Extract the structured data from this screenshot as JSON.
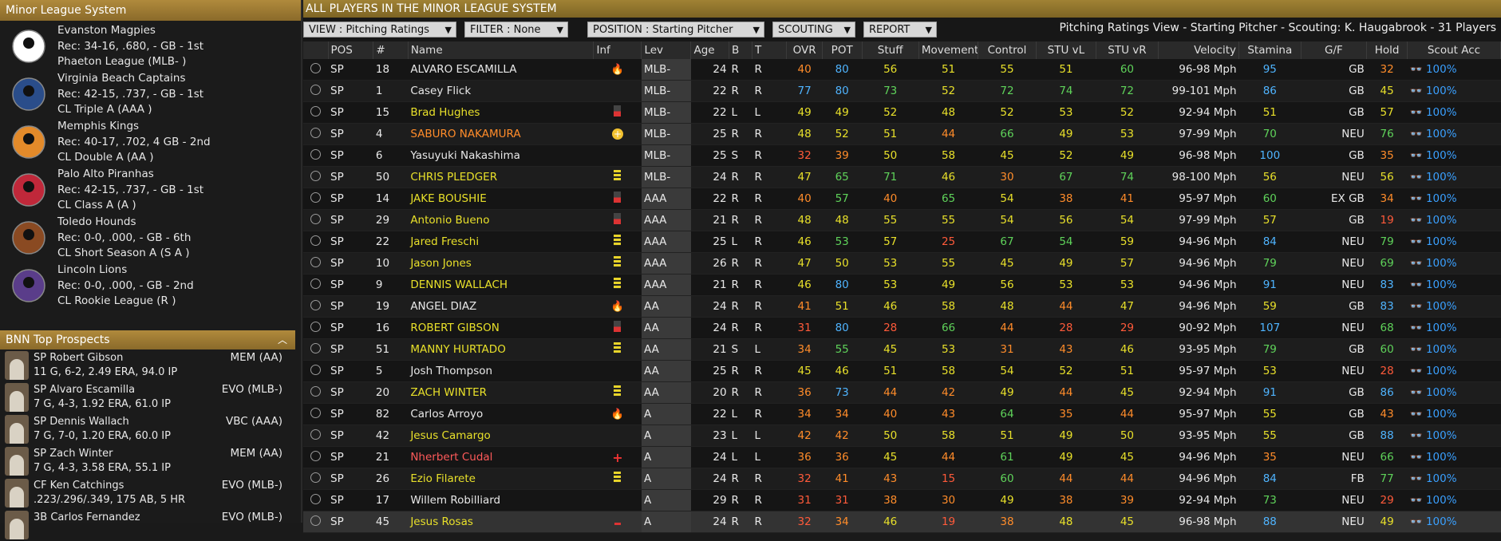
{
  "left_header": "Minor League System",
  "teams": [
    {
      "name": "Evanston Magpies",
      "rec": "Rec: 34-16, .680, - GB - 1st",
      "league": "Phaeton League (MLB- )",
      "color": "#ffffff",
      "icon": "magpie-logo-icon"
    },
    {
      "name": "Virginia Beach Captains",
      "rec": "Rec: 42-15, .737, - GB - 1st",
      "league": "CL Triple A (AAA )",
      "color": "#2a4d8a",
      "icon": "captain-logo-icon"
    },
    {
      "name": "Memphis Kings",
      "rec": "Rec: 40-17, .702, 4 GB - 2nd",
      "league": "CL Double A (AA )",
      "color": "#e38a2a",
      "icon": "crown-logo-icon"
    },
    {
      "name": "Palo Alto Piranhas",
      "rec": "Rec: 42-15, .737, - GB - 1st",
      "league": "CL Class A (A )",
      "color": "#c0283a",
      "icon": "piranha-logo-icon"
    },
    {
      "name": "Toledo Hounds",
      "rec": "Rec: 0-0, .000, - GB - 6th",
      "league": "CL Short Season A (S A )",
      "color": "#8a4a22",
      "icon": "hound-logo-icon"
    },
    {
      "name": "Lincoln Lions",
      "rec": "Rec: 0-0, .000, - GB - 2nd",
      "league": "CL Rookie League (R )",
      "color": "#5a3d8a",
      "icon": "lion-logo-icon"
    }
  ],
  "prospects_header": "BNN Top Prospects",
  "prospects": [
    {
      "name": "SP Robert Gibson",
      "stats": "11 G, 6-2, 2.49 ERA, 94.0 IP",
      "team": "MEM (AA)"
    },
    {
      "name": "SP Alvaro Escamilla",
      "stats": "7 G, 4-3, 1.92 ERA, 61.0 IP",
      "team": "EVO (MLB-)"
    },
    {
      "name": "SP Dennis Wallach",
      "stats": "7 G, 7-0, 1.20 ERA, 60.0 IP",
      "team": "VBC (AAA)"
    },
    {
      "name": "SP Zach Winter",
      "stats": "7 G, 4-3, 3.58 ERA, 55.1 IP",
      "team": "MEM (AA)"
    },
    {
      "name": "CF Ken Catchings",
      "stats": ".223/.296/.349, 175 AB, 5 HR",
      "team": "EVO (MLB-)"
    },
    {
      "name": "3B Carlos Fernandez",
      "stats": "",
      "team": "EVO (MLB-)"
    }
  ],
  "main_header": "ALL PLAYERS IN THE MINOR LEAGUE SYSTEM",
  "toolbar": {
    "view": "VIEW : Pitching Ratings",
    "filter": "FILTER : None",
    "position": "POSITION : Starting Pitcher",
    "scouting": "SCOUTING",
    "report": "REPORT",
    "info": "Pitching Ratings View - Starting Pitcher - Scouting: K. Haugabrook - 31 Players"
  },
  "columns": [
    "",
    "POS",
    "#",
    "Name",
    "Inf",
    "Lev",
    "Age",
    "B",
    "T",
    "OVR",
    "POT",
    "Stuff",
    "Movement",
    "Control",
    "STU vL",
    "STU vR",
    "Velocity",
    "Stamina",
    "G/F",
    "Hold",
    "Scout Acc"
  ],
  "colors": {
    "red": "#ff5a3a",
    "orange": "#ff8c2a",
    "yellow": "#e8e02a",
    "green": "#5fd35a",
    "blue": "#4fb4ff",
    "white": "#e8e8e8",
    "red_name": "#ff5a5a"
  },
  "rows": [
    {
      "pos": "SP",
      "num": "18",
      "name": "ALVARO ESCAMILLA",
      "nc": "white",
      "inf": "fire",
      "lev": "MLB-",
      "age": "24",
      "b": "R",
      "t": "R",
      "ovr": "40",
      "ovrc": "orange",
      "pot": "80",
      "potc": "blue",
      "stuff": "56",
      "stc": "yellow",
      "mov": "51",
      "mvc": "yellow",
      "con": "55",
      "coc": "yellow",
      "vl": "51",
      "vlc": "yellow",
      "vr": "60",
      "vrc": "green",
      "velo": "96-98 Mph",
      "sta": "95",
      "sac": "blue",
      "gf": "GB",
      "hold": "32",
      "hoc": "orange",
      "acc": "100%"
    },
    {
      "pos": "SP",
      "num": "1",
      "name": "Casey Flick",
      "nc": "white",
      "inf": "",
      "lev": "MLB-",
      "age": "22",
      "b": "R",
      "t": "R",
      "ovr": "77",
      "ovrc": "blue",
      "pot": "80",
      "potc": "blue",
      "stuff": "73",
      "stc": "green",
      "mov": "52",
      "mvc": "yellow",
      "con": "72",
      "coc": "green",
      "vl": "74",
      "vlc": "green",
      "vr": "72",
      "vrc": "green",
      "velo": "99-101 Mph",
      "sta": "86",
      "sac": "blue",
      "gf": "GB",
      "hold": "45",
      "hoc": "yellow",
      "acc": "100%"
    },
    {
      "pos": "SP",
      "num": "15",
      "name": "Brad Hughes",
      "nc": "yellow",
      "inf": "bar-red",
      "lev": "MLB-",
      "age": "22",
      "b": "L",
      "t": "L",
      "ovr": "49",
      "ovrc": "yellow",
      "pot": "49",
      "potc": "yellow",
      "stuff": "52",
      "stc": "yellow",
      "mov": "48",
      "mvc": "yellow",
      "con": "52",
      "coc": "yellow",
      "vl": "53",
      "vlc": "yellow",
      "vr": "52",
      "vrc": "yellow",
      "velo": "92-94 Mph",
      "sta": "51",
      "sac": "yellow",
      "gf": "GB",
      "hold": "57",
      "hoc": "yellow",
      "acc": "100%"
    },
    {
      "pos": "SP",
      "num": "4",
      "name": "SABURO NAKAMURA",
      "nc": "orange",
      "inf": "plus-yellow",
      "lev": "MLB-",
      "age": "25",
      "b": "R",
      "t": "R",
      "ovr": "48",
      "ovrc": "yellow",
      "pot": "52",
      "potc": "yellow",
      "stuff": "51",
      "stc": "yellow",
      "mov": "44",
      "mvc": "orange",
      "con": "66",
      "coc": "green",
      "vl": "49",
      "vlc": "yellow",
      "vr": "53",
      "vrc": "yellow",
      "velo": "97-99 Mph",
      "sta": "70",
      "sac": "green",
      "gf": "NEU",
      "hold": "76",
      "hoc": "green",
      "acc": "100%"
    },
    {
      "pos": "SP",
      "num": "6",
      "name": "Yasuyuki Nakashima",
      "nc": "white",
      "inf": "",
      "lev": "MLB-",
      "age": "25",
      "b": "S",
      "t": "R",
      "ovr": "32",
      "ovrc": "red",
      "pot": "39",
      "potc": "orange",
      "stuff": "50",
      "stc": "yellow",
      "mov": "58",
      "mvc": "yellow",
      "con": "45",
      "coc": "yellow",
      "vl": "52",
      "vlc": "yellow",
      "vr": "49",
      "vrc": "yellow",
      "velo": "96-98 Mph",
      "sta": "100",
      "sac": "blue",
      "gf": "GB",
      "hold": "35",
      "hoc": "orange",
      "acc": "100%"
    },
    {
      "pos": "SP",
      "num": "50",
      "name": "CHRIS PLEDGER",
      "nc": "yellow",
      "inf": "bar-yellow",
      "lev": "MLB-",
      "age": "24",
      "b": "R",
      "t": "R",
      "ovr": "47",
      "ovrc": "yellow",
      "pot": "65",
      "potc": "green",
      "stuff": "71",
      "stc": "green",
      "mov": "46",
      "mvc": "yellow",
      "con": "30",
      "coc": "orange",
      "vl": "67",
      "vlc": "green",
      "vr": "74",
      "vrc": "green",
      "velo": "98-100 Mph",
      "sta": "56",
      "sac": "yellow",
      "gf": "NEU",
      "hold": "56",
      "hoc": "yellow",
      "acc": "100%"
    },
    {
      "pos": "SP",
      "num": "14",
      "name": "JAKE BOUSHIE",
      "nc": "yellow",
      "inf": "bar-red",
      "lev": "AAA",
      "age": "22",
      "b": "R",
      "t": "R",
      "ovr": "40",
      "ovrc": "orange",
      "pot": "57",
      "potc": "green",
      "stuff": "40",
      "stc": "orange",
      "mov": "65",
      "mvc": "green",
      "con": "54",
      "coc": "yellow",
      "vl": "38",
      "vlc": "orange",
      "vr": "41",
      "vrc": "orange",
      "velo": "95-97 Mph",
      "sta": "60",
      "sac": "green",
      "gf": "EX GB",
      "hold": "34",
      "hoc": "orange",
      "acc": "100%"
    },
    {
      "pos": "SP",
      "num": "29",
      "name": "Antonio Bueno",
      "nc": "yellow",
      "inf": "bar-red",
      "lev": "AAA",
      "age": "21",
      "b": "R",
      "t": "R",
      "ovr": "48",
      "ovrc": "yellow",
      "pot": "48",
      "potc": "yellow",
      "stuff": "55",
      "stc": "yellow",
      "mov": "55",
      "mvc": "yellow",
      "con": "54",
      "coc": "yellow",
      "vl": "56",
      "vlc": "yellow",
      "vr": "54",
      "vrc": "yellow",
      "velo": "97-99 Mph",
      "sta": "57",
      "sac": "yellow",
      "gf": "GB",
      "hold": "19",
      "hoc": "red",
      "acc": "100%"
    },
    {
      "pos": "SP",
      "num": "22",
      "name": "Jared Freschi",
      "nc": "yellow",
      "inf": "bar-yellow",
      "lev": "AAA",
      "age": "25",
      "b": "L",
      "t": "R",
      "ovr": "46",
      "ovrc": "yellow",
      "pot": "53",
      "potc": "green",
      "stuff": "57",
      "stc": "yellow",
      "mov": "25",
      "mvc": "red",
      "con": "67",
      "coc": "green",
      "vl": "54",
      "vlc": "green",
      "vr": "59",
      "vrc": "yellow",
      "velo": "94-96 Mph",
      "sta": "84",
      "sac": "blue",
      "gf": "NEU",
      "hold": "79",
      "hoc": "green",
      "acc": "100%"
    },
    {
      "pos": "SP",
      "num": "10",
      "name": "Jason Jones",
      "nc": "yellow",
      "inf": "bar-yellow",
      "lev": "AAA",
      "age": "26",
      "b": "R",
      "t": "R",
      "ovr": "47",
      "ovrc": "yellow",
      "pot": "50",
      "potc": "yellow",
      "stuff": "53",
      "stc": "yellow",
      "mov": "55",
      "mvc": "yellow",
      "con": "45",
      "coc": "yellow",
      "vl": "49",
      "vlc": "yellow",
      "vr": "57",
      "vrc": "yellow",
      "velo": "94-96 Mph",
      "sta": "79",
      "sac": "green",
      "gf": "NEU",
      "hold": "69",
      "hoc": "green",
      "acc": "100%"
    },
    {
      "pos": "SP",
      "num": "9",
      "name": "DENNIS WALLACH",
      "nc": "yellow",
      "inf": "bar-yellow",
      "lev": "AAA",
      "age": "21",
      "b": "R",
      "t": "R",
      "ovr": "46",
      "ovrc": "yellow",
      "pot": "80",
      "potc": "blue",
      "stuff": "53",
      "stc": "yellow",
      "mov": "49",
      "mvc": "yellow",
      "con": "56",
      "coc": "yellow",
      "vl": "53",
      "vlc": "yellow",
      "vr": "53",
      "vrc": "yellow",
      "velo": "94-96 Mph",
      "sta": "91",
      "sac": "blue",
      "gf": "NEU",
      "hold": "83",
      "hoc": "blue",
      "acc": "100%"
    },
    {
      "pos": "SP",
      "num": "19",
      "name": "ANGEL DIAZ",
      "nc": "white",
      "inf": "fire",
      "lev": "AA",
      "age": "24",
      "b": "R",
      "t": "R",
      "ovr": "41",
      "ovrc": "orange",
      "pot": "51",
      "potc": "yellow",
      "stuff": "46",
      "stc": "yellow",
      "mov": "58",
      "mvc": "yellow",
      "con": "48",
      "coc": "yellow",
      "vl": "44",
      "vlc": "orange",
      "vr": "47",
      "vrc": "yellow",
      "velo": "94-96 Mph",
      "sta": "59",
      "sac": "yellow",
      "gf": "GB",
      "hold": "83",
      "hoc": "blue",
      "acc": "100%"
    },
    {
      "pos": "SP",
      "num": "16",
      "name": "ROBERT GIBSON",
      "nc": "yellow",
      "inf": "bar-red",
      "lev": "AA",
      "age": "24",
      "b": "R",
      "t": "R",
      "ovr": "31",
      "ovrc": "red",
      "pot": "80",
      "potc": "blue",
      "stuff": "28",
      "stc": "red",
      "mov": "66",
      "mvc": "green",
      "con": "44",
      "coc": "orange",
      "vl": "28",
      "vlc": "red",
      "vr": "29",
      "vrc": "red",
      "velo": "90-92 Mph",
      "sta": "107",
      "sac": "blue",
      "gf": "NEU",
      "hold": "68",
      "hoc": "green",
      "acc": "100%"
    },
    {
      "pos": "SP",
      "num": "51",
      "name": "MANNY HURTADO",
      "nc": "yellow",
      "inf": "bar-yellow",
      "lev": "AA",
      "age": "21",
      "b": "S",
      "t": "L",
      "ovr": "34",
      "ovrc": "orange",
      "pot": "55",
      "potc": "green",
      "stuff": "45",
      "stc": "yellow",
      "mov": "53",
      "mvc": "yellow",
      "con": "31",
      "coc": "orange",
      "vl": "43",
      "vlc": "orange",
      "vr": "46",
      "vrc": "yellow",
      "velo": "93-95 Mph",
      "sta": "79",
      "sac": "green",
      "gf": "GB",
      "hold": "60",
      "hoc": "green",
      "acc": "100%"
    },
    {
      "pos": "SP",
      "num": "5",
      "name": "Josh Thompson",
      "nc": "white",
      "inf": "",
      "lev": "AA",
      "age": "25",
      "b": "R",
      "t": "R",
      "ovr": "45",
      "ovrc": "yellow",
      "pot": "46",
      "potc": "yellow",
      "stuff": "51",
      "stc": "yellow",
      "mov": "58",
      "mvc": "yellow",
      "con": "54",
      "coc": "yellow",
      "vl": "52",
      "vlc": "yellow",
      "vr": "51",
      "vrc": "yellow",
      "velo": "95-97 Mph",
      "sta": "53",
      "sac": "yellow",
      "gf": "NEU",
      "hold": "28",
      "hoc": "red",
      "acc": "100%"
    },
    {
      "pos": "SP",
      "num": "20",
      "name": "ZACH WINTER",
      "nc": "yellow",
      "inf": "bar-yellow",
      "lev": "AA",
      "age": "20",
      "b": "R",
      "t": "R",
      "ovr": "36",
      "ovrc": "orange",
      "pot": "73",
      "potc": "blue",
      "stuff": "44",
      "stc": "orange",
      "mov": "42",
      "mvc": "orange",
      "con": "49",
      "coc": "yellow",
      "vl": "44",
      "vlc": "orange",
      "vr": "45",
      "vrc": "yellow",
      "velo": "92-94 Mph",
      "sta": "91",
      "sac": "blue",
      "gf": "GB",
      "hold": "86",
      "hoc": "blue",
      "acc": "100%"
    },
    {
      "pos": "SP",
      "num": "82",
      "name": "Carlos Arroyo",
      "nc": "white",
      "inf": "fire",
      "lev": "A",
      "age": "22",
      "b": "L",
      "t": "R",
      "ovr": "34",
      "ovrc": "orange",
      "pot": "34",
      "potc": "orange",
      "stuff": "40",
      "stc": "orange",
      "mov": "43",
      "mvc": "orange",
      "con": "64",
      "coc": "green",
      "vl": "35",
      "vlc": "orange",
      "vr": "44",
      "vrc": "orange",
      "velo": "95-97 Mph",
      "sta": "55",
      "sac": "yellow",
      "gf": "GB",
      "hold": "43",
      "hoc": "orange",
      "acc": "100%"
    },
    {
      "pos": "SP",
      "num": "42",
      "name": "Jesus Camargo",
      "nc": "yellow",
      "inf": "",
      "lev": "A",
      "age": "23",
      "b": "L",
      "t": "L",
      "ovr": "42",
      "ovrc": "orange",
      "pot": "42",
      "potc": "orange",
      "stuff": "50",
      "stc": "yellow",
      "mov": "58",
      "mvc": "yellow",
      "con": "51",
      "coc": "yellow",
      "vl": "49",
      "vlc": "yellow",
      "vr": "50",
      "vrc": "yellow",
      "velo": "93-95 Mph",
      "sta": "55",
      "sac": "yellow",
      "gf": "GB",
      "hold": "88",
      "hoc": "blue",
      "acc": "100%"
    },
    {
      "pos": "SP",
      "num": "21",
      "name": "Nherbert Cudal",
      "nc": "red_name",
      "inf": "cross-red",
      "lev": "A",
      "age": "24",
      "b": "L",
      "t": "L",
      "ovr": "36",
      "ovrc": "orange",
      "pot": "36",
      "potc": "orange",
      "stuff": "45",
      "stc": "yellow",
      "mov": "44",
      "mvc": "orange",
      "con": "61",
      "coc": "green",
      "vl": "49",
      "vlc": "yellow",
      "vr": "45",
      "vrc": "yellow",
      "velo": "94-96 Mph",
      "sta": "35",
      "sac": "orange",
      "gf": "NEU",
      "hold": "66",
      "hoc": "green",
      "acc": "100%"
    },
    {
      "pos": "SP",
      "num": "26",
      "name": "Ezio Filarete",
      "nc": "yellow",
      "inf": "bar-yellow",
      "lev": "A",
      "age": "24",
      "b": "R",
      "t": "R",
      "ovr": "32",
      "ovrc": "red",
      "pot": "41",
      "potc": "orange",
      "stuff": "43",
      "stc": "orange",
      "mov": "15",
      "mvc": "red",
      "con": "60",
      "coc": "green",
      "vl": "44",
      "vlc": "orange",
      "vr": "44",
      "vrc": "orange",
      "velo": "94-96 Mph",
      "sta": "84",
      "sac": "blue",
      "gf": "FB",
      "hold": "77",
      "hoc": "green",
      "acc": "100%"
    },
    {
      "pos": "SP",
      "num": "17",
      "name": "Willem Robilliard",
      "nc": "white",
      "inf": "",
      "lev": "A",
      "age": "29",
      "b": "R",
      "t": "R",
      "ovr": "31",
      "ovrc": "red",
      "pot": "31",
      "potc": "red",
      "stuff": "38",
      "stc": "orange",
      "mov": "30",
      "mvc": "orange",
      "con": "49",
      "coc": "yellow",
      "vl": "38",
      "vlc": "orange",
      "vr": "39",
      "vrc": "orange",
      "velo": "92-94 Mph",
      "sta": "73",
      "sac": "green",
      "gf": "NEU",
      "hold": "29",
      "hoc": "red",
      "acc": "100%"
    },
    {
      "pos": "SP",
      "num": "45",
      "name": "Jesus Rosas",
      "nc": "yellow",
      "inf": "dash-red",
      "lev": "A",
      "age": "24",
      "b": "R",
      "t": "R",
      "ovr": "32",
      "ovrc": "red",
      "pot": "34",
      "potc": "orange",
      "stuff": "46",
      "stc": "yellow",
      "mov": "19",
      "mvc": "red",
      "con": "38",
      "coc": "orange",
      "vl": "48",
      "vlc": "yellow",
      "vr": "45",
      "vrc": "yellow",
      "velo": "96-98 Mph",
      "sta": "88",
      "sac": "blue",
      "gf": "NEU",
      "hold": "49",
      "hoc": "yellow",
      "acc": "100%"
    }
  ]
}
